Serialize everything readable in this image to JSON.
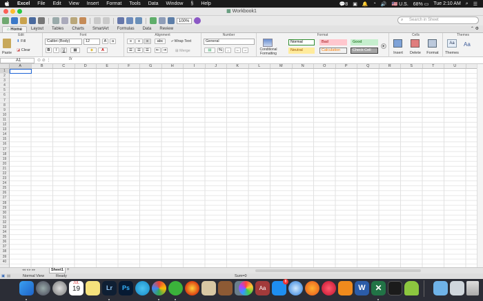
{
  "menubar": {
    "app": "Excel",
    "items": [
      "File",
      "Edit",
      "View",
      "Insert",
      "Format",
      "Tools",
      "Data",
      "Window",
      "Help"
    ],
    "wechat_badge": "8",
    "input_source": "U.S.",
    "battery": "68%",
    "clock": "Tue 2:10 AM"
  },
  "window": {
    "title": "Workbook1"
  },
  "toolbar": {
    "zoom": "100%",
    "search_placeholder": "Search in Sheet"
  },
  "ribbon": {
    "tabs": [
      "Home",
      "Layout",
      "Tables",
      "Charts",
      "SmartArt",
      "Formulas",
      "Data",
      "Review"
    ],
    "active_tab": "Home",
    "groups": [
      "Edit",
      "Font",
      "Alignment",
      "Number",
      "Format",
      "Cells",
      "Themes"
    ],
    "edit": {
      "paste": "Paste",
      "fill": "Fill",
      "clear": "Clear"
    },
    "font": {
      "name": "Calibri (Body)",
      "size": "12",
      "bold": "B",
      "italic": "I",
      "underline": "U"
    },
    "alignment": {
      "wrap": "Wrap Text",
      "merge": "Merge",
      "abc": "abc"
    },
    "number": {
      "format": "General",
      "percent": "%"
    },
    "format": {
      "conditional": "Conditional Formatting",
      "styles": [
        {
          "label": "Normal",
          "bg": "#ffffff",
          "fg": "#000000",
          "border": "#2e8b2e"
        },
        {
          "label": "Bad",
          "bg": "#ffc7ce",
          "fg": "#9c0006",
          "border": "#ffc7ce"
        },
        {
          "label": "Good",
          "bg": "#c6efce",
          "fg": "#006100",
          "border": "#c6efce"
        },
        {
          "label": "Neutral",
          "bg": "#ffeb9c",
          "fg": "#9c5700",
          "border": "#ffeb9c"
        },
        {
          "label": "Calculation",
          "bg": "#f2f2f2",
          "fg": "#fa7d00",
          "border": "#7f7f7f"
        },
        {
          "label": "Check Cell",
          "bg": "#a5a5a5",
          "fg": "#ffffff",
          "border": "#3f3f3f"
        }
      ]
    },
    "cells": {
      "insert": "Insert",
      "delete": "Delete",
      "format": "Format"
    },
    "themes": {
      "themes": "Themes",
      "aa": "Aa"
    }
  },
  "formula_bar": {
    "cell_ref": "A1",
    "fx": "fx",
    "value": ""
  },
  "grid": {
    "columns": [
      "A",
      "B",
      "C",
      "D",
      "E",
      "F",
      "G",
      "H",
      "I",
      "J",
      "K",
      "L",
      "M",
      "N",
      "O",
      "P",
      "Q",
      "R",
      "S",
      "T",
      "U"
    ],
    "rows": [
      "1",
      "2",
      "3",
      "4",
      "5",
      "6",
      "7",
      "8",
      "9",
      "10",
      "11",
      "12",
      "13",
      "14",
      "15",
      "16",
      "17",
      "18",
      "19",
      "20",
      "21",
      "22",
      "23",
      "24",
      "25",
      "26",
      "27",
      "28",
      "29",
      "30",
      "31",
      "32",
      "33",
      "34",
      "35",
      "36",
      "37",
      "38",
      "39",
      "40"
    ],
    "selected": "A1"
  },
  "sheets": {
    "tabs": [
      "Sheet1"
    ],
    "add": "+"
  },
  "status": {
    "view": "Normal View",
    "state": "Ready",
    "sum": "Sum=0"
  },
  "dock": {
    "calendar_month": "JUL",
    "calendar_day": "19",
    "lightroom": "Lr",
    "photoshop": "Ps",
    "app_store_badge": "8",
    "dictionary": "Aa",
    "word": "W",
    "colors": {
      "accent": "#1c63d5",
      "excel_green": "#217346",
      "menubar": "#1b1b1b"
    }
  }
}
